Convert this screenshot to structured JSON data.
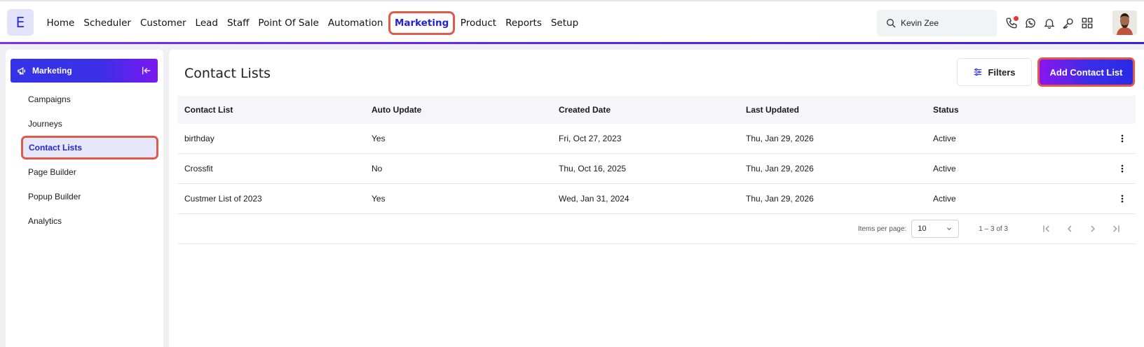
{
  "app": {
    "logo_letter": "E"
  },
  "nav": {
    "items": [
      "Home",
      "Scheduler",
      "Customer",
      "Lead",
      "Staff",
      "Point Of Sale",
      "Automation",
      "Marketing",
      "Product",
      "Reports",
      "Setup"
    ],
    "active": "Marketing"
  },
  "search": {
    "value": "Kevin Zee",
    "icon": "search-icon"
  },
  "top_icons": [
    "phone-icon",
    "whatsapp-icon",
    "bell-icon",
    "key-icon",
    "apps-grid-icon"
  ],
  "sidebar": {
    "title": "Marketing",
    "items": [
      "Campaigns",
      "Journeys",
      "Contact Lists",
      "Page Builder",
      "Popup Builder",
      "Analytics"
    ],
    "active": "Contact Lists"
  },
  "main": {
    "title": "Contact Lists",
    "filters_label": "Filters",
    "add_label": "Add Contact List"
  },
  "table": {
    "headers": [
      "Contact List",
      "Auto Update",
      "Created Date",
      "Last Updated",
      "Status"
    ],
    "rows": [
      [
        "birthday",
        "Yes",
        "Fri, Oct 27, 2023",
        "Thu, Jan 29, 2026",
        "Active"
      ],
      [
        "Crossfit",
        "No",
        "Thu, Oct 16, 2025",
        "Thu, Jan 29, 2026",
        "Active"
      ],
      [
        "Custmer List of 2023",
        "Yes",
        "Wed, Jan 31, 2024",
        "Thu, Jan 29, 2026",
        "Active"
      ]
    ]
  },
  "pager": {
    "items_per_page_label": "Items per page:",
    "items_per_page_value": "10",
    "range": "1 – 3 of 3"
  },
  "colors": {
    "accent": "#2323d6",
    "highlight_border": "#e05a4a",
    "gradient_start": "#8a16f0",
    "gradient_end": "#2a2ae6"
  }
}
